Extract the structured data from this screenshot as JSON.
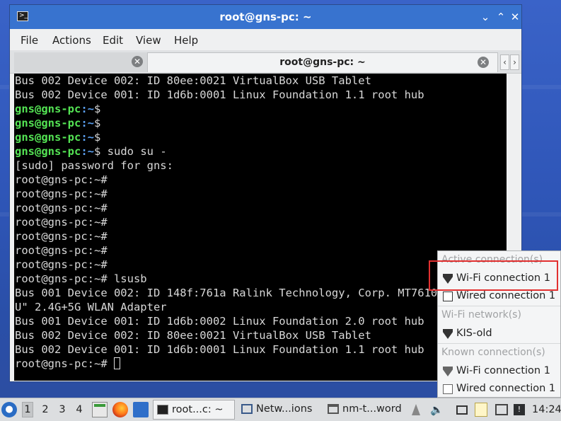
{
  "window": {
    "title": "root@gns-pc: ~",
    "menu": [
      "File",
      "Actions",
      "Edit",
      "View",
      "Help"
    ],
    "tabs": [
      {
        "label": "",
        "active": false
      },
      {
        "label": "root@gns-pc: ~",
        "active": true
      }
    ]
  },
  "terminal": {
    "lines": [
      {
        "type": "out",
        "text": "Bus 002 Device 002: ID 80ee:0021 VirtualBox USB Tablet"
      },
      {
        "type": "out",
        "text": "Bus 002 Device 001: ID 1d6b:0001 Linux Foundation 1.1 root hub"
      },
      {
        "type": "user",
        "user": "gns@gns-pc",
        "path": ":~",
        "sym": "$",
        "cmd": ""
      },
      {
        "type": "user",
        "user": "gns@gns-pc",
        "path": ":~",
        "sym": "$",
        "cmd": ""
      },
      {
        "type": "user",
        "user": "gns@gns-pc",
        "path": ":~",
        "sym": "$",
        "cmd": ""
      },
      {
        "type": "user",
        "user": "gns@gns-pc",
        "path": ":~",
        "sym": "$",
        "cmd": " sudo su -"
      },
      {
        "type": "out",
        "text": "[sudo] password for gns:"
      },
      {
        "type": "out",
        "text": "root@gns-pc:~#"
      },
      {
        "type": "out",
        "text": "root@gns-pc:~#"
      },
      {
        "type": "out",
        "text": "root@gns-pc:~#"
      },
      {
        "type": "out",
        "text": "root@gns-pc:~#"
      },
      {
        "type": "out",
        "text": "root@gns-pc:~#"
      },
      {
        "type": "out",
        "text": "root@gns-pc:~#"
      },
      {
        "type": "out",
        "text": "root@gns-pc:~#"
      },
      {
        "type": "out",
        "text": "root@gns-pc:~# lsusb"
      },
      {
        "type": "out",
        "text": "Bus 001 Device 002: ID 148f:761a Ralink Technology, Corp. MT7610U (\"Archer T2"
      },
      {
        "type": "out",
        "text": "U\" 2.4G+5G WLAN Adapter"
      },
      {
        "type": "out",
        "text": "Bus 001 Device 001: ID 1d6b:0002 Linux Foundation 2.0 root hub"
      },
      {
        "type": "out",
        "text": "Bus 002 Device 002: ID 80ee:0021 VirtualBox USB Tablet"
      },
      {
        "type": "out",
        "text": "Bus 002 Device 001: ID 1d6b:0001 Linux Foundation 1.1 root hub"
      },
      {
        "type": "cursor",
        "text": "root@gns-pc:~# "
      }
    ]
  },
  "network_menu": {
    "active_header": "Active connection(s)",
    "active": [
      {
        "label": "Wi-Fi connection 1",
        "icon": "wifi-icon"
      },
      {
        "label": "Wired connection 1",
        "icon": "wired-icon"
      }
    ],
    "wifi_header": "Wi-Fi network(s)",
    "wifi": [
      {
        "label": "KIS-old",
        "icon": "wifi-icon"
      }
    ],
    "known_header": "Known connection(s)",
    "known": [
      {
        "label": "Wi-Fi connection 1",
        "icon": "wifi-icon"
      },
      {
        "label": "Wired connection 1",
        "icon": "wired-icon"
      }
    ]
  },
  "taskbar": {
    "desktops": [
      "1",
      "2",
      "3",
      "4"
    ],
    "active_desktop": "1",
    "tasks": [
      {
        "label": "root...c: ~",
        "icon": "terminal-icon",
        "active": true
      },
      {
        "label": "Netw...ions",
        "icon": "network-icon",
        "active": false
      },
      {
        "label": "nm-t...word",
        "icon": "window-icon",
        "active": false
      }
    ],
    "clock": "14:24"
  },
  "colors": {
    "titlebar": "#3873cf",
    "terminal_bg": "#000000",
    "prompt_user": "#54e454",
    "prompt_path": "#5ba0f0",
    "highlight_box": "#e23030"
  }
}
